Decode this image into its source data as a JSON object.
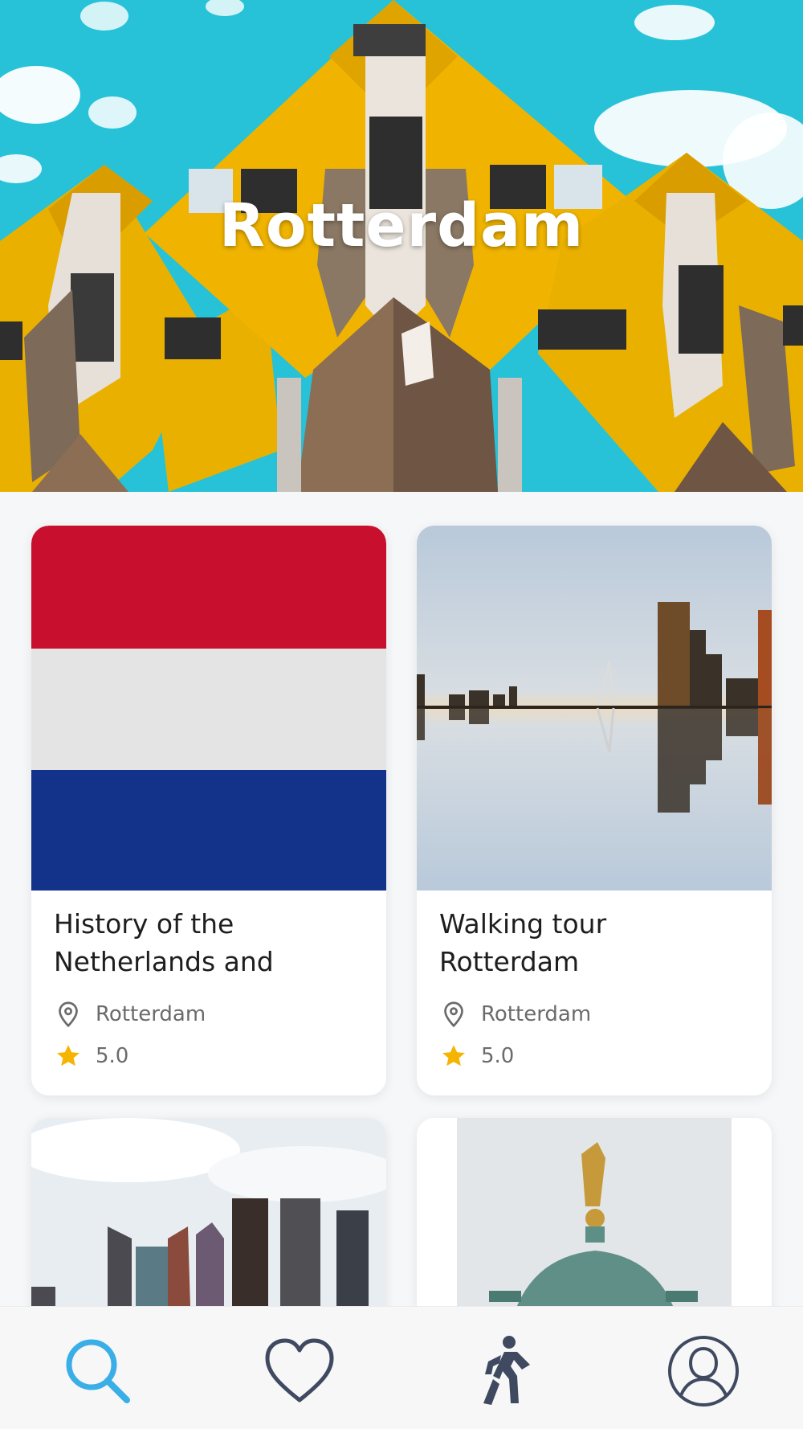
{
  "hero": {
    "title": "Rotterdam"
  },
  "cards": [
    {
      "title": "History of the Netherlands and",
      "location": "Rotterdam",
      "rating": "5.0",
      "image": "netherlands-flag"
    },
    {
      "title": "Walking tour Rotterdam",
      "location": "Rotterdam",
      "rating": "5.0",
      "image": "skyline-reflection"
    },
    {
      "title": "",
      "location": "",
      "rating": "",
      "image": "city-skyline"
    },
    {
      "title": "",
      "location": "",
      "rating": "",
      "image": "golden-statue-dome"
    }
  ],
  "nav": {
    "items": [
      {
        "icon": "search-icon",
        "active": true
      },
      {
        "icon": "heart-icon",
        "active": false
      },
      {
        "icon": "walking-person-icon",
        "active": false
      },
      {
        "icon": "profile-icon",
        "active": false
      }
    ]
  },
  "colors": {
    "active_nav": "#3aaee6",
    "inactive_nav": "#3f4960",
    "star": "#f5b400",
    "flag_red": "#c8102e",
    "flag_white": "#e6e6e6",
    "flag_blue": "#13338a"
  }
}
